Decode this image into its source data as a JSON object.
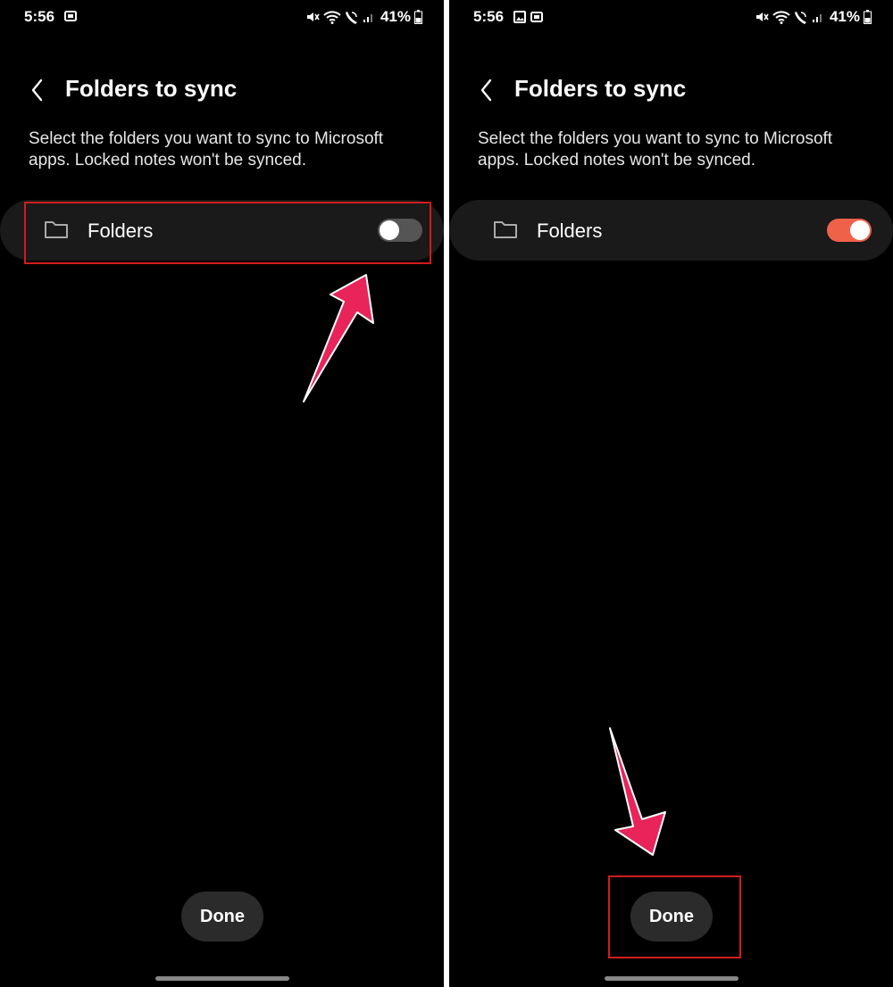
{
  "screens": [
    {
      "status_bar": {
        "time": "5:56",
        "battery": "41%"
      },
      "header": {
        "title": "Folders to sync"
      },
      "description": "Select the folders you want to sync to Microsoft apps. Locked notes won't be synced.",
      "row": {
        "label": "Folders",
        "toggle_state": "off"
      },
      "done_label": "Done"
    },
    {
      "status_bar": {
        "time": "5:56",
        "battery": "41%"
      },
      "header": {
        "title": "Folders to sync"
      },
      "description": "Select the folders you want to sync to Microsoft apps. Locked notes won't be synced.",
      "row": {
        "label": "Folders",
        "toggle_state": "on"
      },
      "done_label": "Done"
    }
  ],
  "colors": {
    "toggle_on": "#f0614a",
    "toggle_off": "#555555",
    "highlight_box": "#d21c1c",
    "arrow": "#e8245a"
  },
  "icons": [
    "back-chevron-icon",
    "folder-icon",
    "mute-icon",
    "wifi-icon",
    "wifi-calling-icon",
    "signal-icon",
    "battery-icon",
    "video-icon",
    "image-icon"
  ]
}
